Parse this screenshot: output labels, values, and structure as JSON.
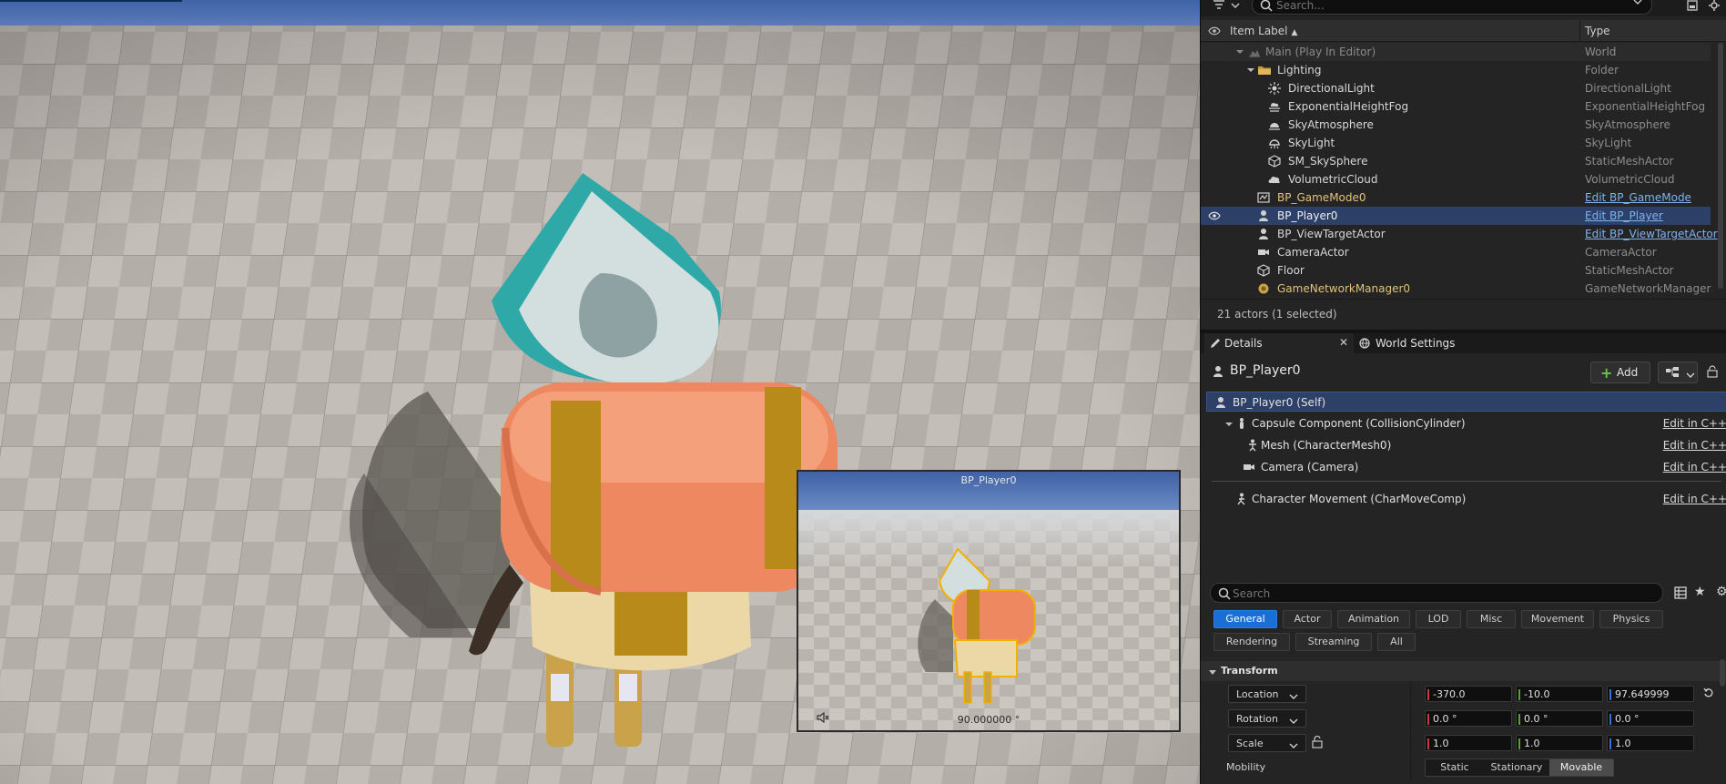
{
  "outliner": {
    "search_placeholder": "Search...",
    "columns": {
      "label": "Item Label",
      "type": "Type"
    },
    "rows": [
      {
        "label": "Main (Play In Editor)",
        "type": "World"
      },
      {
        "label": "Lighting",
        "type": "Folder"
      },
      {
        "label": "DirectionalLight",
        "type": "DirectionalLight"
      },
      {
        "label": "ExponentialHeightFog",
        "type": "ExponentialHeightFog"
      },
      {
        "label": "SkyAtmosphere",
        "type": "SkyAtmosphere"
      },
      {
        "label": "SkyLight",
        "type": "SkyLight"
      },
      {
        "label": "SM_SkySphere",
        "type": "StaticMeshActor"
      },
      {
        "label": "VolumetricCloud",
        "type": "VolumetricCloud"
      },
      {
        "label": "BP_GameMode0",
        "type": "Edit BP_GameMode"
      },
      {
        "label": "BP_Player0",
        "type": "Edit BP_Player"
      },
      {
        "label": "BP_ViewTargetActor",
        "type": "Edit BP_ViewTargetActor"
      },
      {
        "label": "CameraActor",
        "type": "CameraActor"
      },
      {
        "label": "Floor",
        "type": "StaticMeshActor"
      },
      {
        "label": "GameNetworkManager0",
        "type": "GameNetworkManager"
      }
    ],
    "status": "21 actors (1 selected)"
  },
  "details": {
    "tabs": {
      "details": "Details",
      "world_settings": "World Settings"
    },
    "actor_name": "BP_Player0",
    "add_label": "Add",
    "components": [
      {
        "label": "BP_Player0 (Self)",
        "edit": ""
      },
      {
        "label": "Capsule Component (CollisionCylinder)",
        "edit": "Edit in C++"
      },
      {
        "label": "Mesh (CharacterMesh0)",
        "edit": "Edit in C++"
      },
      {
        "label": "Camera (Camera)",
        "edit": "Edit in C++"
      },
      {
        "label": "Character Movement (CharMoveComp)",
        "edit": "Edit in C++"
      }
    ],
    "search_placeholder": "Search",
    "categories": [
      "General",
      "Actor",
      "Animation",
      "LOD",
      "Misc",
      "Movement",
      "Physics",
      "Rendering",
      "Streaming",
      "All"
    ],
    "active_category": "General",
    "transform": {
      "header": "Transform",
      "location": {
        "label": "Location",
        "x": "-370.0",
        "y": "-10.0",
        "z": "97.649999"
      },
      "rotation": {
        "label": "Rotation",
        "x": "0.0 °",
        "y": "0.0 °",
        "z": "0.0 °"
      },
      "scale": {
        "label": "Scale",
        "x": "1.0",
        "y": "1.0",
        "z": "1.0"
      },
      "mobility": {
        "label": "Mobility",
        "options": [
          "Static",
          "Stationary",
          "Movable"
        ],
        "selected": "Movable"
      }
    }
  },
  "preview": {
    "title": "BP_Player0",
    "angle": "90.000000 °"
  },
  "colors": {
    "selection": "#2c4068",
    "accent": "#1a6fd6",
    "link": "#7fb2f0",
    "axis_x": "#c43c3c",
    "axis_y": "#5aa02c",
    "axis_z": "#3a6fd4"
  }
}
